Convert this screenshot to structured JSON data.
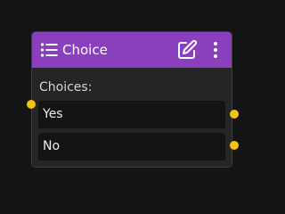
{
  "node": {
    "title": "Choice",
    "header_color": "#8a3fbd",
    "icons": {
      "title_icon": "list-icon",
      "edit_icon": "edit-icon",
      "menu_icon": "more-vertical-icon"
    },
    "choices_label": "Choices:",
    "choices": [
      {
        "label": "Yes"
      },
      {
        "label": "No"
      }
    ],
    "port_color": "#f2c311"
  }
}
